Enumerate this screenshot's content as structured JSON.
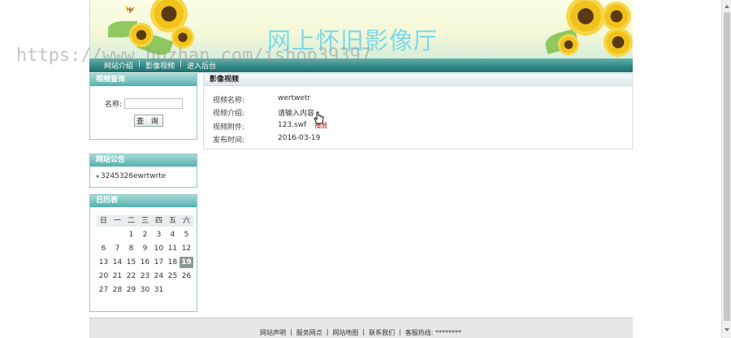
{
  "banner": {
    "site_title": "网上怀旧影像厅",
    "watermark": "https://www.huzhan.com/ishop39397"
  },
  "nav": {
    "items": [
      "网站介绍",
      "影像视频",
      "进入后台"
    ],
    "separator": "|"
  },
  "sidebar": {
    "search": {
      "title": "视频查询",
      "name_label": "名称:",
      "name_value": "",
      "button_label": "查 询"
    },
    "notice": {
      "title": "网站公告",
      "items": [
        "3245326ewrtwrte"
      ]
    },
    "calendar": {
      "title": "日历表",
      "weekdays": [
        "日",
        "一",
        "二",
        "三",
        "四",
        "五",
        "六"
      ],
      "weeks": [
        [
          "",
          "",
          "1",
          "2",
          "3",
          "4",
          "5"
        ],
        [
          "6",
          "7",
          "8",
          "9",
          "10",
          "11",
          "12"
        ],
        [
          "13",
          "14",
          "15",
          "16",
          "17",
          "18",
          "19"
        ],
        [
          "20",
          "21",
          "22",
          "23",
          "24",
          "25",
          "26"
        ],
        [
          "27",
          "28",
          "29",
          "30",
          "31",
          "",
          ""
        ]
      ],
      "today": "19"
    }
  },
  "main": {
    "title": "影像视频",
    "fields": [
      {
        "label": "视频名称:",
        "value": "wertwetr"
      },
      {
        "label": "视频介绍:",
        "value": "请输入内容"
      },
      {
        "label": "视频附件:",
        "value": "123.swf",
        "action": "播放"
      },
      {
        "label": "发布时间:",
        "value": "2016-03-19"
      }
    ]
  },
  "footer": {
    "links": [
      "网站声明",
      "服务网点",
      "网站地图",
      "联系我们",
      "客服热线: ********"
    ],
    "separator": "|"
  },
  "colors": {
    "nav_bg": "#2f8683",
    "panel_header": "#54b0ad",
    "link_red": "#c0141e",
    "title_cyan": "#7fd8e8"
  }
}
